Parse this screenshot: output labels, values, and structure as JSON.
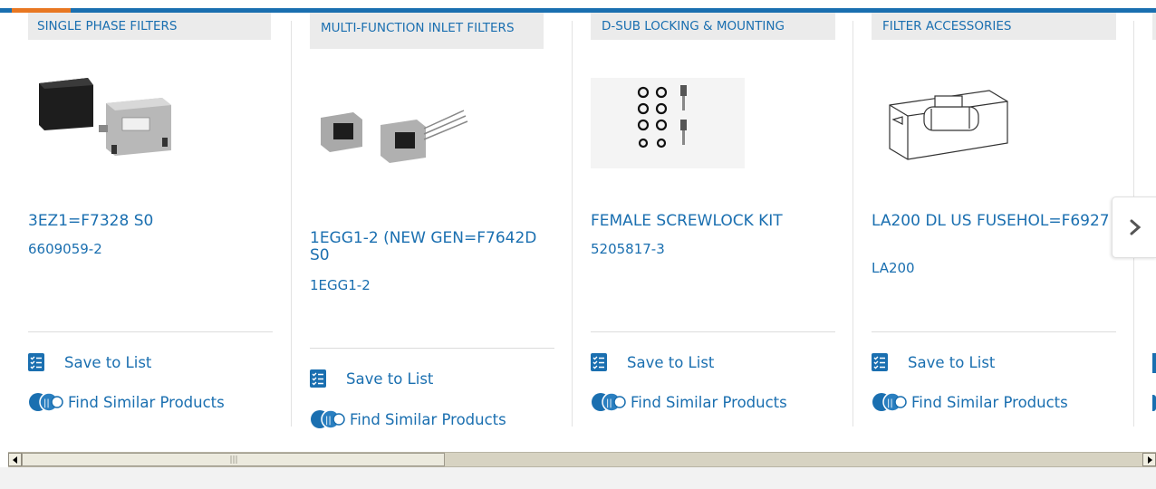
{
  "nav": {
    "next_label": ""
  },
  "cards": [
    {
      "category": "SINGLE PHASE FILTERS",
      "name": "3EZ1=F7328 S0",
      "part": "6609059-2",
      "save": "Save to List",
      "similar": "Find Similar Products"
    },
    {
      "category": "MULTI-FUNCTION INLET FILTERS",
      "name": "1EGG1-2 (NEW GEN=F7642D S0",
      "part": "1EGG1-2",
      "save": "Save to List",
      "similar": "Find Similar Products"
    },
    {
      "category": "D-SUB LOCKING & MOUNTING",
      "name": "FEMALE SCREWLOCK KIT",
      "part": "5205817-3",
      "save": "Save to List",
      "similar": "Find Similar Products"
    },
    {
      "category": "FILTER ACCESSORIES",
      "name": "LA200 DL US FUSEHOL=F6927",
      "part": "LA200",
      "save": "Save to List",
      "similar": "Find Similar Products"
    }
  ],
  "scrollbar": {
    "thumb_fraction": 0.37
  },
  "colors": {
    "brand_blue": "#1a6fb0",
    "accent_orange": "#e87722",
    "category_bg": "#ebebeb"
  }
}
